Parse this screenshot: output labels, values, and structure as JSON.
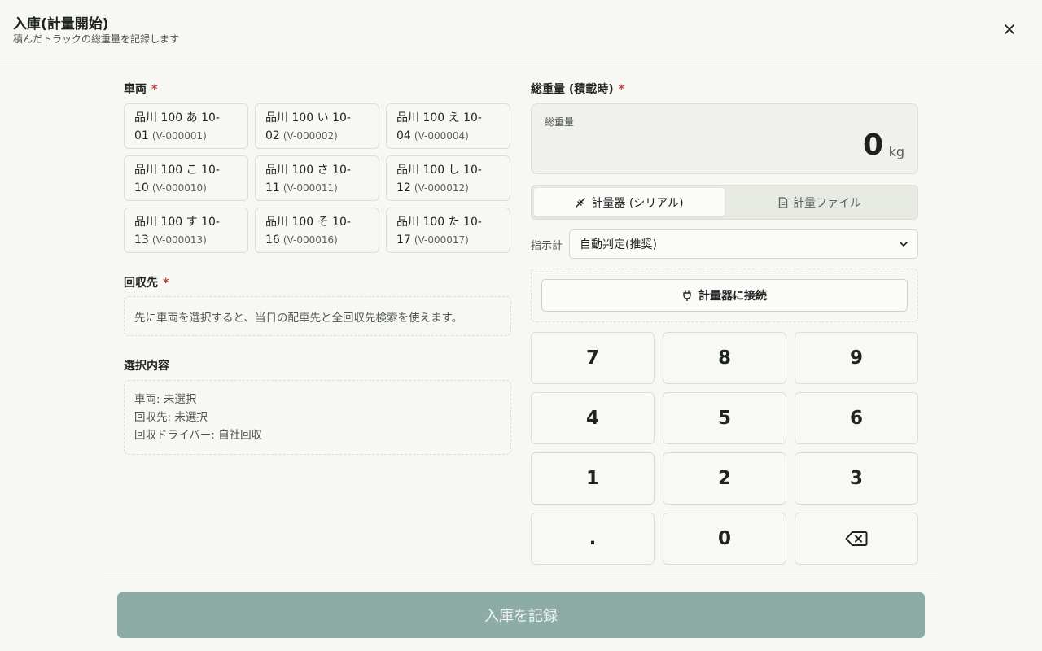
{
  "header": {
    "title": "入庫(計量開始)",
    "subtitle": "積んだトラックの総重量を記録します",
    "close_label": "×"
  },
  "vehicle": {
    "label": "車両",
    "required_mark": "*",
    "items": [
      {
        "line1": "品川 100 あ 10-",
        "line2": "01",
        "code": "(V-000001)"
      },
      {
        "line1": "品川 100 い 10-",
        "line2": "02",
        "code": "(V-000002)"
      },
      {
        "line1": "品川 100 え 10-",
        "line2": "04",
        "code": "(V-000004)"
      },
      {
        "line1": "品川 100 こ 10-",
        "line2": "10",
        "code": "(V-000010)"
      },
      {
        "line1": "品川 100 さ 10-",
        "line2": "11",
        "code": "(V-000011)"
      },
      {
        "line1": "品川 100 し 10-",
        "line2": "12",
        "code": "(V-000012)"
      },
      {
        "line1": "品川 100 す 10-",
        "line2": "13",
        "code": "(V-000013)"
      },
      {
        "line1": "品川 100 そ 10-",
        "line2": "16",
        "code": "(V-000016)"
      },
      {
        "line1": "品川 100 た 10-",
        "line2": "17",
        "code": "(V-000017)"
      }
    ]
  },
  "destination": {
    "label": "回収先",
    "required_mark": "*",
    "placeholder": "先に車両を選択すると、当日の配車先と全回収先検索を使えます。"
  },
  "summary": {
    "label": "選択内容",
    "vehicle_line": "車両: 未選択",
    "destination_line": "回収先: 未選択",
    "driver_line": "回収ドライバー: 自社回収"
  },
  "weight": {
    "label": "総重量 (積載時)",
    "required_mark": "*",
    "box_label": "総重量",
    "value": "0",
    "unit": "kg"
  },
  "tabs": [
    {
      "label": "計量器 (シリアル)",
      "icon": "scale-serial-icon",
      "active": true
    },
    {
      "label": "計量ファイル",
      "icon": "file-icon",
      "active": false
    }
  ],
  "indicator": {
    "label": "指示計",
    "selected": "自動判定(推奨)"
  },
  "connect": {
    "label": "計量器に接続",
    "icon": "plug-icon"
  },
  "keypad": {
    "keys": [
      "7",
      "8",
      "9",
      "4",
      "5",
      "6",
      "1",
      "2",
      "3",
      ".",
      "0"
    ],
    "backspace_icon": "backspace-icon"
  },
  "submit": {
    "label": "入庫を記録"
  },
  "colors": {
    "required": "#d9342b",
    "submit_disabled": "#8daca5",
    "background": "#f7f7f4"
  }
}
